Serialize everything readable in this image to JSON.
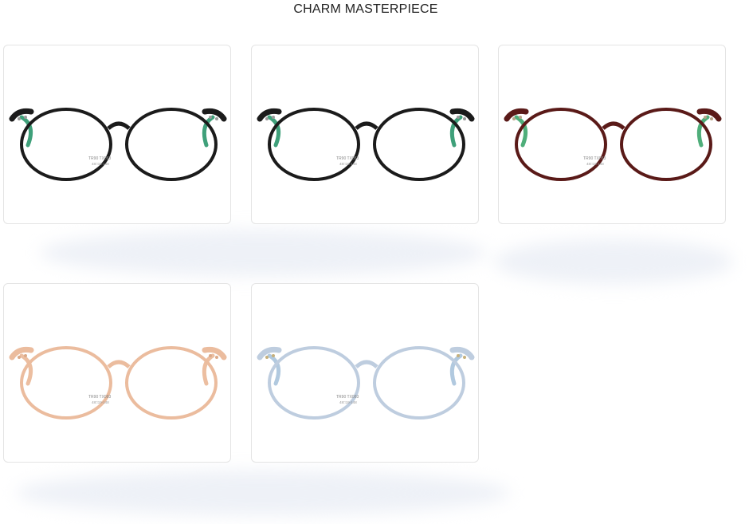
{
  "header": {
    "title": "CHARM MASTERPIECE"
  },
  "products": [
    {
      "frame_color": "black",
      "stroke": "#1b1b1b",
      "fill": "#2a2a2a",
      "temple": "#3fa07a",
      "rivet": "#9a9a9a",
      "opacity": 1.0,
      "temple_text": "TR90 TX083",
      "size_text": "48□19-148"
    },
    {
      "frame_color": "black",
      "stroke": "#1b1b1b",
      "fill": "#2a2a2a",
      "temple": "#3fa07a",
      "rivet": "#9a9a9a",
      "opacity": 1.0,
      "temple_text": "TR90 TX083",
      "size_text": "48□19-148"
    },
    {
      "frame_color": "burgundy",
      "stroke": "#5a1a18",
      "fill": "#4a1614",
      "temple": "#4fae7a",
      "rivet": "#b8a58a",
      "opacity": 1.0,
      "temple_text": "TR90 TX083",
      "size_text": "48□19-148"
    },
    {
      "frame_color": "peach-clear",
      "stroke": "#e9b594",
      "fill": "#f2c8ac",
      "temple": "#eab896",
      "rivet": "#d8a07c",
      "opacity": 0.9,
      "temple_text": "TR90 TX083",
      "size_text": "48□19-148"
    },
    {
      "frame_color": "clear-blue",
      "stroke": "#b8c8dc",
      "fill": "#cdd9e7",
      "temple": "#a9c4dc",
      "rivet": "#c0a86e",
      "opacity": 0.9,
      "temple_text": "TR90 TX083",
      "size_text": "48□19-148"
    }
  ]
}
